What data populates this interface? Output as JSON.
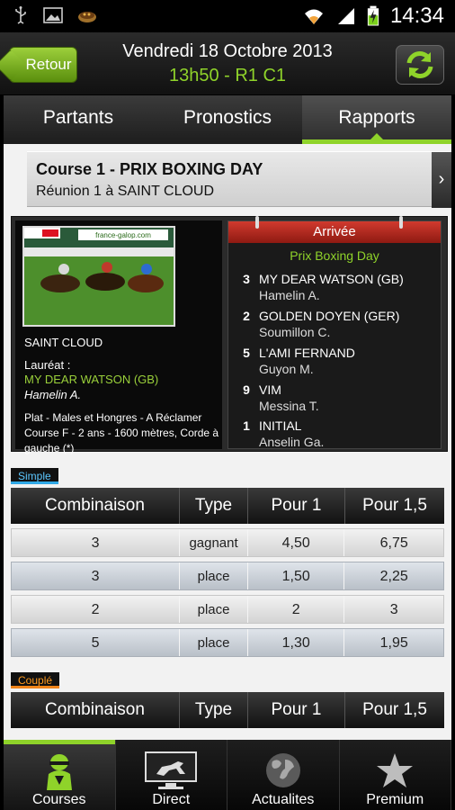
{
  "status_bar": {
    "time": "14:34",
    "icons": [
      "usb-icon",
      "image-icon",
      "food-icon",
      "wifi-icon",
      "signal-icon",
      "battery-charging-icon"
    ]
  },
  "header": {
    "back_label": "Retour",
    "date": "Vendredi 18 Octobre 2013",
    "race_code": "13h50 - R1 C1",
    "refresh_icon": "refresh-icon"
  },
  "tabs": [
    {
      "label": "Partants",
      "active": false
    },
    {
      "label": "Pronostics",
      "active": false
    },
    {
      "label": "Rapports",
      "active": true
    }
  ],
  "race": {
    "title": "Course 1 - PRIX BOXING DAY",
    "subtitle": "Réunion 1 à SAINT CLOUD",
    "photo_banner": "france-galop.com",
    "place": "SAINT CLOUD",
    "laureat_label": "Lauréat :",
    "laureat_name": "MY DEAR WATSON (GB)",
    "laureat_jockey": "Hamelin A.",
    "description": "Plat - Males et Hongres - A Réclamer Course F - 2 ans - 1600 mètres, Corde à gauche (*)"
  },
  "arrivee": {
    "title": "Arrivée",
    "race_name": "Prix Boxing Day",
    "runners": [
      {
        "num": "3",
        "name": "MY DEAR WATSON (GB)",
        "jockey": "Hamelin A."
      },
      {
        "num": "2",
        "name": "GOLDEN DOYEN (GER)",
        "jockey": "Soumillon C."
      },
      {
        "num": "5",
        "name": "L'AMI FERNAND",
        "jockey": "Guyon M."
      },
      {
        "num": "9",
        "name": "VIM",
        "jockey": "Messina T."
      },
      {
        "num": "1",
        "name": "INITIAL",
        "jockey": "Anselin Ga."
      }
    ]
  },
  "simple": {
    "label": "Simple",
    "headers": [
      "Combinaison",
      "Type",
      "Pour 1",
      "Pour 1,5"
    ],
    "rows": [
      [
        "3",
        "gagnant",
        "4,50",
        "6,75"
      ],
      [
        "3",
        "place",
        "1,50",
        "2,25"
      ],
      [
        "2",
        "place",
        "2",
        "3"
      ],
      [
        "5",
        "place",
        "1,30",
        "1,95"
      ]
    ]
  },
  "couple": {
    "label": "Couplé",
    "headers": [
      "Combinaison",
      "Type",
      "Pour 1",
      "Pour 1,5"
    ]
  },
  "bottom_nav": [
    {
      "label": "Courses",
      "icon": "jockey-icon",
      "active": true
    },
    {
      "label": "Direct",
      "icon": "tv-horse-icon",
      "active": false
    },
    {
      "label": "Actualites",
      "icon": "globe-icon",
      "active": false
    },
    {
      "label": "Premium",
      "icon": "star-icon",
      "active": false
    }
  ],
  "colors": {
    "accent_green": "#8fd32a",
    "arrivee_red": "#c22a1f",
    "simple_blue": "#2fa8e6",
    "couple_orange": "#f0841a"
  }
}
